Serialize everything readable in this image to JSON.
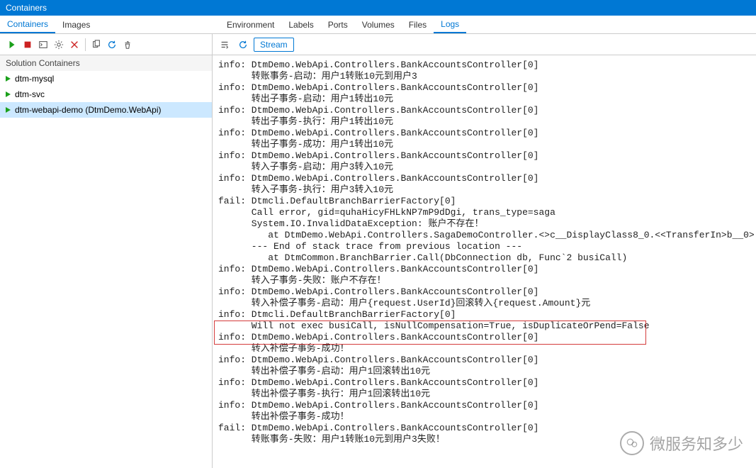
{
  "titlebar": {
    "title": "Containers"
  },
  "leftTabs": {
    "containers": "Containers",
    "images": "Images"
  },
  "rightTabs": {
    "environment": "Environment",
    "labels": "Labels",
    "ports": "Ports",
    "volumes": "Volumes",
    "files": "Files",
    "logs": "Logs"
  },
  "sectionHeader": "Solution Containers",
  "containers": {
    "item0": "dtm-mysql",
    "item1": "dtm-svc",
    "item2": "dtm-webapi-demo (DtmDemo.WebApi)"
  },
  "streamBtn": "Stream",
  "watermark": "微服务知多少",
  "logs": "info: DtmDemo.WebApi.Controllers.BankAccountsController[0]\n      转账事务-启动：用户1转账10元到用户3\ninfo: DtmDemo.WebApi.Controllers.BankAccountsController[0]\n      转出子事务-启动：用户1转出10元\ninfo: DtmDemo.WebApi.Controllers.BankAccountsController[0]\n      转出子事务-执行：用户1转出10元\ninfo: DtmDemo.WebApi.Controllers.BankAccountsController[0]\n      转出子事务-成功：用户1转出10元\ninfo: DtmDemo.WebApi.Controllers.BankAccountsController[0]\n      转入子事务-启动：用户3转入10元\ninfo: DtmDemo.WebApi.Controllers.BankAccountsController[0]\n      转入子事务-执行：用户3转入10元\nfail: Dtmcli.DefaultBranchBarrierFactory[0]\n      Call error, gid=quhaHicyFHLkNP7mP9dDgi, trans_type=saga\n      System.IO.InvalidDataException: 账户不存在！\n         at DtmDemo.WebApi.Controllers.SagaDemoController.<>c__DisplayClass8_0.<<TransferIn>b__0>\n      --- End of stack trace from previous location ---\n         at DtmCommon.BranchBarrier.Call(DbConnection db, Func`2 busiCall)\ninfo: DtmDemo.WebApi.Controllers.BankAccountsController[0]\n      转入子事务-失败：账户不存在！\ninfo: DtmDemo.WebApi.Controllers.BankAccountsController[0]\n      转入补偿子事务-启动：用户{request.UserId}回滚转入{request.Amount}元\ninfo: Dtmcli.DefaultBranchBarrierFactory[0]\n      Will not exec busiCall, isNullCompensation=True, isDuplicateOrPend=False\ninfo: DtmDemo.WebApi.Controllers.BankAccountsController[0]\n      转入补偿子事务-成功！\ninfo: DtmDemo.WebApi.Controllers.BankAccountsController[0]\n      转出补偿子事务-启动：用户1回滚转出10元\ninfo: DtmDemo.WebApi.Controllers.BankAccountsController[0]\n      转出补偿子事务-执行：用户1回滚转出10元\ninfo: DtmDemo.WebApi.Controllers.BankAccountsController[0]\n      转出补偿子事务-成功！\nfail: DtmDemo.WebApi.Controllers.BankAccountsController[0]\n      转账事务-失败：用户1转账10元到用户3失败！"
}
